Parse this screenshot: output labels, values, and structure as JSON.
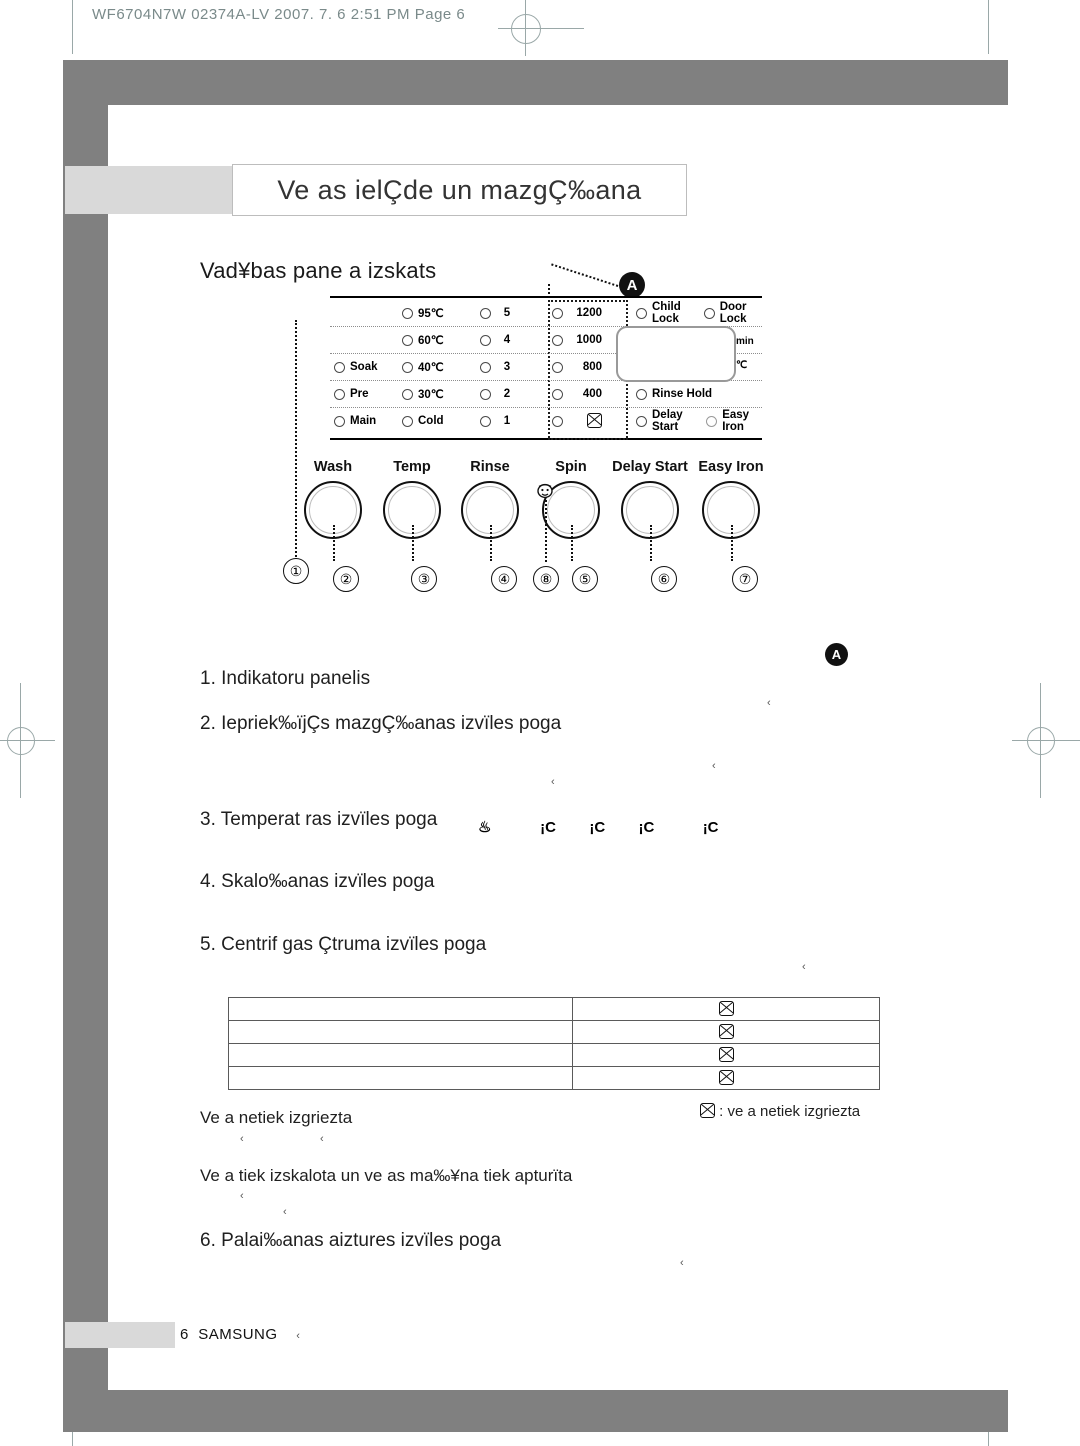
{
  "print_header": "WF6704N7W 02374A-LV   2007. 7. 6   2:51 PM   Page 6",
  "title": "Ve as ielÇde un mazgÇ‰ana",
  "section_heading": "Vad¥bas pane a izskats",
  "control_panel": {
    "callout_label": "A",
    "wash_options": [
      "Soak",
      "Pre",
      "Main"
    ],
    "temperatures": [
      "95℃",
      "60℃",
      "40℃",
      "30℃",
      "Cold"
    ],
    "rinse_levels": [
      "5",
      "4",
      "3",
      "2",
      "1"
    ],
    "spin_speeds": [
      "1200",
      "1000",
      "800",
      "400",
      "no-spin"
    ],
    "indicators": [
      "Child Lock",
      "Door Lock",
      "Rinse Hold",
      "Delay Start",
      "Easy Iron"
    ],
    "display_units": {
      "minutes": "min",
      "celsius": "℃"
    },
    "knobs": [
      {
        "label": "Wash",
        "number": "②"
      },
      {
        "label": "Temp",
        "number": "③"
      },
      {
        "label": "Rinse",
        "number": "④"
      },
      {
        "label": "Spin",
        "number": "⑤"
      },
      {
        "label": "Delay Start",
        "number": "⑥"
      },
      {
        "label": "Easy Iron",
        "number": "⑦"
      }
    ],
    "panel_number": "①",
    "childlock_number": "⑧"
  },
  "list": [
    {
      "num": "1.",
      "text": "Indikatoru panelis"
    },
    {
      "num": "2.",
      "text": "Iepriek‰ïjÇs mazgÇ‰anas izvïles poga"
    },
    {
      "num": "3.",
      "text": "Temperat ras izvïles poga"
    },
    {
      "num": "4.",
      "text": "Skalo‰anas izvïles poga"
    },
    {
      "num": "5.",
      "text": "Centrif gas Çtruma izvïles poga"
    },
    {
      "num": "6.",
      "text": "Palai‰anas aiztures izvïles poga"
    }
  ],
  "temp_icons": [
    "♨",
    "¡C",
    "¡C",
    "¡C",
    "¡C"
  ],
  "table": {
    "rows": [
      {
        "left": "",
        "right": "no-spin"
      },
      {
        "left": "",
        "right": "no-spin"
      },
      {
        "left": "",
        "right": "no-spin"
      },
      {
        "left": "",
        "right": "no-spin"
      }
    ]
  },
  "captions": {
    "no_spin": "Ve a netiek izgriezta",
    "rinse_hold": "Ve a tiek izskalota un ve as ma‰¥na tiek apturïta",
    "note_right": ": ve a netiek izgriezta"
  },
  "footer": {
    "page": "6",
    "brand": "SAMSUNG"
  }
}
